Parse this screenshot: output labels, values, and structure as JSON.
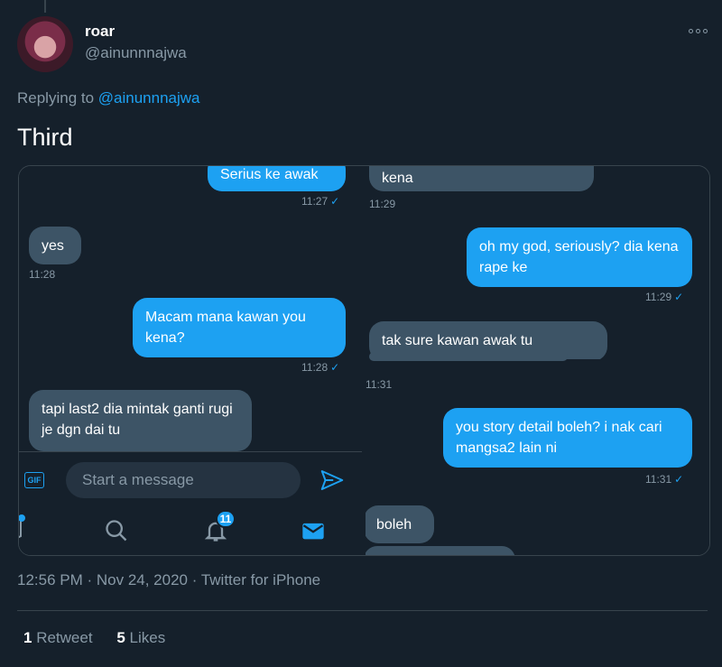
{
  "author": {
    "display_name": "roar",
    "handle": "@ainunnnajwa"
  },
  "replying": {
    "prefix": "Replying to ",
    "handle": "@ainunnnajwa"
  },
  "tweet": {
    "text": "Third"
  },
  "left_shot": {
    "messages": [
      {
        "dir": "out",
        "text": "Serius ke awak",
        "time": "11:27"
      },
      {
        "dir": "in",
        "text": "yes",
        "time": "11:28"
      },
      {
        "dir": "out",
        "text": "Macam mana kawan you kena?",
        "time": "11:28"
      },
      {
        "dir": "in",
        "text": "tapi last2 dia mintak ganti rugi je dgn dai tu",
        "time": ""
      }
    ],
    "composer_placeholder": "Start a message",
    "gif_label": "GIF",
    "notification_count": "11"
  },
  "right_shot": {
    "messages": [
      {
        "dir": "in",
        "text": "kena",
        "time": "11:29"
      },
      {
        "dir": "out",
        "text": "oh my god, seriously? dia kena rape ke",
        "time": "11:29"
      },
      {
        "dir": "in",
        "text": "tak sure kawan awak tu",
        "time": "11:31"
      },
      {
        "dir": "out",
        "text": "you story detail boleh? i nak cari mangsa2 lain ni",
        "time": "11:31"
      },
      {
        "dir": "in",
        "text": "boleh",
        "time": ""
      }
    ]
  },
  "meta": {
    "time": "12:56 PM",
    "date": "Nov 24, 2020",
    "source": "Twitter for iPhone",
    "sep": " · "
  },
  "stats": {
    "retweets": "1",
    "retweets_label": "Retweet",
    "likes": "5",
    "likes_label": "Likes"
  },
  "colors": {
    "accent": "#1da1f2",
    "background": "#15202b",
    "incoming_bubble": "#3d5466",
    "muted": "#8899a6"
  },
  "icons": [
    "more-icon",
    "gif-icon",
    "send-icon",
    "home-icon",
    "search-icon",
    "bell-icon",
    "mail-icon"
  ]
}
